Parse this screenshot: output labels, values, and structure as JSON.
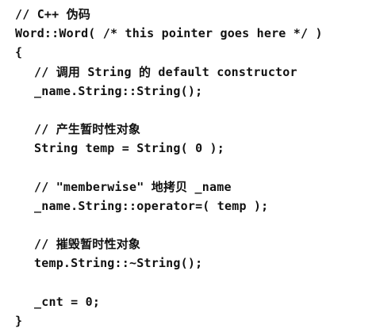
{
  "code": {
    "lines": [
      {
        "text": "// C++ 伪码",
        "indent": 0
      },
      {
        "text": "Word::Word( /* this pointer goes here */ )",
        "indent": 0
      },
      {
        "text": "{",
        "indent": 0
      },
      {
        "text": "// 调用 String 的 default constructor",
        "indent": 1
      },
      {
        "text": "_name.String::String();",
        "indent": 1
      },
      {
        "text": "",
        "indent": 0
      },
      {
        "text": "// 产生暂时性对象",
        "indent": 1
      },
      {
        "text": "String temp = String( 0 );",
        "indent": 1
      },
      {
        "text": "",
        "indent": 0
      },
      {
        "text": "// \"memberwise\" 地拷贝 _name",
        "indent": 1
      },
      {
        "text": "_name.String::operator=( temp );",
        "indent": 1
      },
      {
        "text": "",
        "indent": 0
      },
      {
        "text": "// 摧毁暂时性对象",
        "indent": 1
      },
      {
        "text": "temp.String::~String();",
        "indent": 1
      },
      {
        "text": "",
        "indent": 0
      },
      {
        "text": "_cnt = 0;",
        "indent": 1
      },
      {
        "text": "}",
        "indent": 0
      }
    ]
  }
}
